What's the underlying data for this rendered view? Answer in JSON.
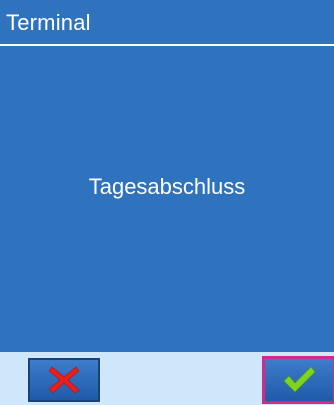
{
  "title_bar": {
    "title": "Terminal"
  },
  "main": {
    "message": "Tagesabschluss"
  },
  "buttons": {
    "cancel_icon": "x-icon",
    "confirm_icon": "checkmark-icon"
  },
  "colors": {
    "primary_blue": "#2f72bd",
    "button_bar": "#cfe7fb",
    "cancel_red": "#e8201c",
    "confirm_green": "#7ed321",
    "selection_border": "#d3298a"
  }
}
